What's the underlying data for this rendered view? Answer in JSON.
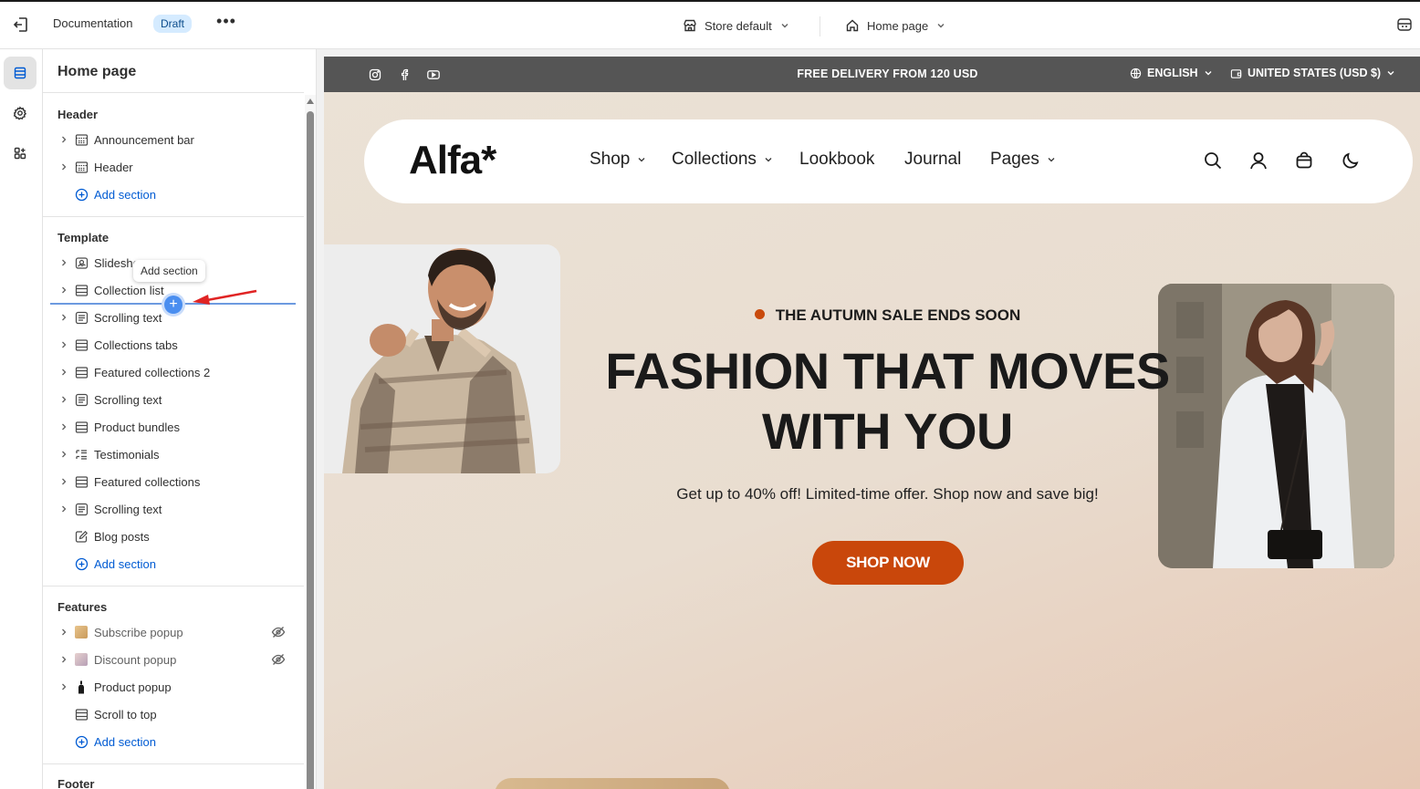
{
  "topbar": {
    "doc_title": "Documentation",
    "status_badge": "Draft",
    "more": "•••",
    "store_selector": "Store default",
    "page_selector": "Home page"
  },
  "rail": {
    "items": [
      {
        "icon": "sections-icon",
        "active": true
      },
      {
        "icon": "gear-icon",
        "active": false
      },
      {
        "icon": "apps-icon",
        "active": false
      }
    ]
  },
  "sidebar": {
    "title": "Home page",
    "groups": {
      "header": {
        "title": "Header",
        "items": [
          "Announcement bar",
          "Header"
        ],
        "add_label": "Add section"
      },
      "template": {
        "title": "Template",
        "items": [
          "Slideshow",
          "Collection list",
          "Scrolling text",
          "Collections tabs",
          "Featured collections 2",
          "Scrolling text",
          "Product bundles",
          "Testimonials",
          "Featured collections",
          "Scrolling text",
          "Blog posts"
        ],
        "add_label": "Add section"
      },
      "features": {
        "title": "Features",
        "items": [
          "Subscribe popup",
          "Discount popup",
          "Product popup",
          "Scroll to top"
        ],
        "add_label": "Add section"
      },
      "footer": {
        "title": "Footer"
      }
    },
    "tooltip": "Add section",
    "insert_icon": "+"
  },
  "preview": {
    "announcement": {
      "text": "FREE DELIVERY FROM 120 USD",
      "language": "ENGLISH",
      "currency": "UNITED STATES (USD $)"
    },
    "nav": {
      "logo": "Alfa*",
      "items": [
        "Shop",
        "Collections",
        "Lookbook",
        "Journal",
        "Pages"
      ]
    },
    "hero": {
      "eyebrow": "THE AUTUMN SALE ENDS SOON",
      "headline_line1": "FASHION THAT MOVES",
      "headline_line2": "WITH YOU",
      "subtext": "Get up to 40% off! Limited-time offer. Shop now and save big!",
      "cta": "SHOP NOW"
    }
  },
  "colors": {
    "accent_blue": "#005bd3",
    "cta_orange": "#c9470b",
    "announcement_bg": "#555555"
  }
}
